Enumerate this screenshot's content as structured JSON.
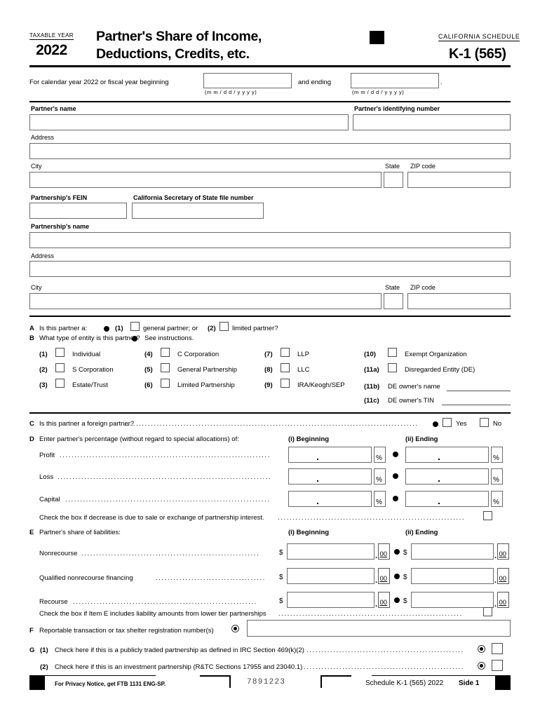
{
  "header": {
    "taxable_year_label": "TAXABLE YEAR",
    "year": "2022",
    "title_line1": "Partner's Share of Income,",
    "title_line2": "Deductions, Credits, etc.",
    "california_schedule_label": "CALIFORNIA SCHEDULE",
    "schedule_number": "K-1 (565)"
  },
  "period": {
    "text_before": "For calendar year 2022 or fiscal year beginning",
    "text_between": "and ending",
    "period_end": ".",
    "begin_value": "",
    "end_value": "",
    "date_hint": "(m m / d   d / y   y   y   y)"
  },
  "partner": {
    "name_label": "Partner's name",
    "name_value": "",
    "identifying_number_label": "Partner's identifying number",
    "identifying_number_value": "",
    "address_label": "Address",
    "address_value": "",
    "city_label": "City",
    "city_value": "",
    "state_label": "State",
    "state_value": "",
    "zip_label": "ZIP code",
    "zip_value": ""
  },
  "partnership": {
    "fein_label": "Partnership's FEIN",
    "fein_value": "",
    "sos_label": "California Secretary of State file number",
    "sos_value": "",
    "name_label": "Partnership's name",
    "name_value": "",
    "address_label": "Address",
    "address_value": "",
    "city_label": "City",
    "city_value": "",
    "state_label": "State",
    "state_value": "",
    "zip_label": "ZIP code",
    "zip_value": ""
  },
  "item_a": {
    "letter": "A",
    "question": "Is this partner a:",
    "opt1_num": "(1)",
    "opt1_label": "general partner; or",
    "opt2_num": "(2)",
    "opt2_label": "limited partner?",
    "opt1_checked": false,
    "opt2_checked": false
  },
  "item_b": {
    "letter": "B",
    "question": "What type of entity is this partner?",
    "see_instructions": "See instructions.",
    "column1": [
      {
        "num": "(1)",
        "label": "Individual",
        "checked": false
      },
      {
        "num": "(2)",
        "label": "S Corporation",
        "checked": false
      },
      {
        "num": "(3)",
        "label": "Estate/Trust",
        "checked": false
      }
    ],
    "column2": [
      {
        "num": "(4)",
        "label": "C Corporation",
        "checked": false
      },
      {
        "num": "(5)",
        "label": "General Partnership",
        "checked": false
      },
      {
        "num": "(6)",
        "label": "Limited Partnership",
        "checked": false
      }
    ],
    "column3": [
      {
        "num": "(7)",
        "label": "LLP",
        "checked": false
      },
      {
        "num": "(8)",
        "label": "LLC",
        "checked": false
      },
      {
        "num": "(9)",
        "label": "IRA/Keogh/SEP",
        "checked": false
      }
    ],
    "column4": [
      {
        "num": "(10)",
        "label": "Exempt Organization",
        "checked": false
      },
      {
        "num": "(11a)",
        "label": "Disregarded Entity (DE)",
        "checked": false
      }
    ],
    "de_owner_name": {
      "num": "(11b)",
      "label": "DE owner's name",
      "value": ""
    },
    "de_owner_tin": {
      "num": "(11c)",
      "label": "DE owner's TIN",
      "value": ""
    }
  },
  "item_c": {
    "letter": "C",
    "question": "Is this partner a foreign partner?",
    "yes_label": "Yes",
    "no_label": "No",
    "yes_checked": false,
    "no_checked": false
  },
  "item_d": {
    "letter": "D",
    "question": "Enter partner's percentage (without regard to special allocations) of:",
    "col_beginning": "(i) Beginning",
    "col_ending": "(ii) Ending",
    "percent_symbol": "%",
    "rows": [
      {
        "label": "Profit",
        "beginning": "",
        "ending": ""
      },
      {
        "label": "Loss",
        "beginning": "",
        "ending": ""
      },
      {
        "label": "Capital",
        "beginning": "",
        "ending": ""
      }
    ],
    "checkbox_note": "Check the box if decrease is due to sale or exchange of partnership interest.",
    "checkbox_checked": false
  },
  "item_e": {
    "letter": "E",
    "question": "Partner's share of liabilities:",
    "col_beginning": "(i) Beginning",
    "col_ending": "(ii) Ending",
    "dollar_symbol": "$",
    "cents": "00",
    "rows": [
      {
        "label": "Nonrecourse",
        "beginning": "",
        "ending": ""
      },
      {
        "label": "Qualified nonrecourse financing",
        "beginning": "",
        "ending": ""
      },
      {
        "label": "Recourse",
        "beginning": "",
        "ending": ""
      }
    ],
    "checkbox_note": "Check the box if Item E includes liability amounts from lower tier partnerships",
    "checkbox_checked": false
  },
  "item_f": {
    "letter": "F",
    "label": "Reportable transaction or tax shelter registration number(s)",
    "value": ""
  },
  "item_g": {
    "letter": "G",
    "rows": [
      {
        "num": "(1)",
        "label": "Check here if this is a publicly traded partnership as defined in IRC Section 469(k)(2)",
        "checked": false
      },
      {
        "num": "(2)",
        "label": "Check here if this is an investment partnership (R&TC Sections 17955 and 23040.1)",
        "checked": false
      }
    ]
  },
  "footer": {
    "privacy_notice": "For Privacy Notice, get FTB 1131 ENG-SP.",
    "form_code": "7891223",
    "schedule_text": "Schedule K-1 (565)  2022",
    "side_text": "Side 1"
  }
}
